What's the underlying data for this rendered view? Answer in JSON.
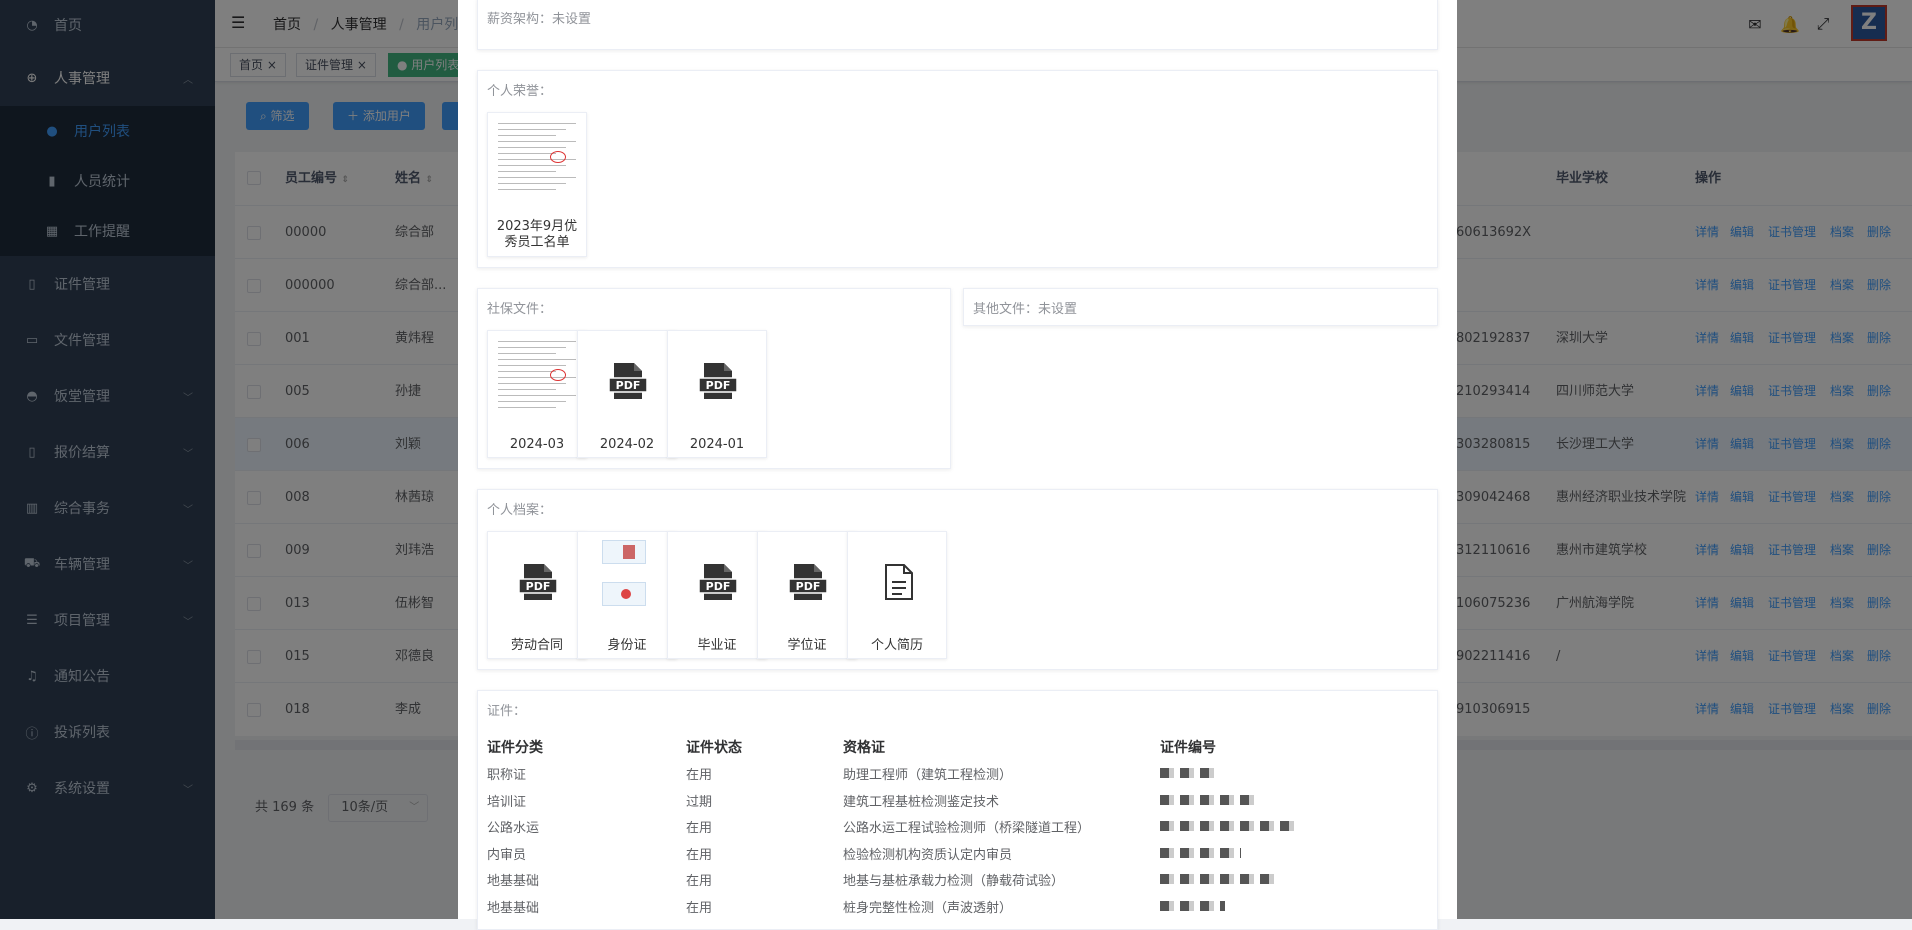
{
  "sidebar": {
    "items": [
      {
        "label": "首页",
        "icon": "dashboard-icon"
      },
      {
        "label": "人事管理",
        "icon": "plus-circle-icon",
        "expanded": true
      },
      {
        "label": "用户列表",
        "icon": "user-icon",
        "sub": true,
        "active": true
      },
      {
        "label": "人员统计",
        "icon": "bar-chart-icon",
        "sub": true
      },
      {
        "label": "工作提醒",
        "icon": "calendar-icon",
        "sub": true
      },
      {
        "label": "证件管理",
        "icon": "book-icon"
      },
      {
        "label": "文件管理",
        "icon": "folder-icon"
      },
      {
        "label": "饭堂管理",
        "icon": "bowl-icon",
        "chevron": true
      },
      {
        "label": "报价结算",
        "icon": "document-icon",
        "chevron": true
      },
      {
        "label": "综合事务",
        "icon": "chart-icon",
        "chevron": true
      },
      {
        "label": "车辆管理",
        "icon": "truck-icon",
        "chevron": true
      },
      {
        "label": "项目管理",
        "icon": "list-icon",
        "chevron": true
      },
      {
        "label": "通知公告",
        "icon": "bell-icon"
      },
      {
        "label": "投诉列表",
        "icon": "warning-icon"
      },
      {
        "label": "系统设置",
        "icon": "gear-icon",
        "chevron": true
      }
    ]
  },
  "navbar": {
    "breadcrumb": [
      "首页",
      "人事管理",
      "用户列表"
    ],
    "separator": "/"
  },
  "tags": [
    "首页",
    "证件管理",
    "用户列表"
  ],
  "toolbar": {
    "filter_label": "筛选",
    "add_label": "添加用户"
  },
  "table": {
    "headers": {
      "id": "员工编号",
      "name": "姓名",
      "school": "毕业学校",
      "ops": "操作"
    },
    "rows": [
      {
        "id": "00000",
        "name": "综合部",
        "idno": "60613692X",
        "school": ""
      },
      {
        "id": "000000",
        "name": "综合部...",
        "idno": "",
        "school": ""
      },
      {
        "id": "001",
        "name": "黄炜程",
        "idno": "802192837",
        "school": "深圳大学"
      },
      {
        "id": "005",
        "name": "孙捷",
        "idno": "210293414",
        "school": "四川师范大学"
      },
      {
        "id": "006",
        "name": "刘颖",
        "idno": "303280815",
        "school": "长沙理工大学"
      },
      {
        "id": "008",
        "name": "林茜琼",
        "idno": "309042468",
        "school": "惠州经济职业技术学院"
      },
      {
        "id": "009",
        "name": "刘玮浩",
        "idno": "312110616",
        "school": "惠州市建筑学校"
      },
      {
        "id": "013",
        "name": "伍彬智",
        "idno": "106075236",
        "school": "广州航海学院"
      },
      {
        "id": "015",
        "name": "邓德良",
        "idno": "902211416",
        "school": "/"
      },
      {
        "id": "018",
        "name": "李成",
        "idno": "910306915",
        "school": ""
      }
    ],
    "ops": [
      "详情",
      "编辑",
      "证书管理",
      "档案",
      "删除"
    ]
  },
  "pagination": {
    "total": "共 169 条",
    "page_size": "10条/页"
  },
  "dialog": {
    "salary_label": "薪资架构：未设置",
    "honors_label": "个人荣誉：",
    "honors": [
      {
        "caption": "2023年9月优秀员工名单"
      }
    ],
    "social_label": "社保文件：",
    "social": [
      {
        "caption": "2024-03",
        "kind": "image"
      },
      {
        "caption": "2024-02",
        "kind": "pdf"
      },
      {
        "caption": "2024-01",
        "kind": "pdf"
      }
    ],
    "other_label": "其他文件：未设置",
    "archive_label": "个人档案：",
    "archive": [
      {
        "caption": "劳动合同",
        "kind": "pdf"
      },
      {
        "caption": "身份证",
        "kind": "image"
      },
      {
        "caption": "毕业证",
        "kind": "pdf"
      },
      {
        "caption": "学位证",
        "kind": "pdf"
      },
      {
        "caption": "个人简历",
        "kind": "doc"
      }
    ],
    "pdf_text": "PDF",
    "cert_label": "证件：",
    "cert_headers": [
      "证件分类",
      "证件状态",
      "资格证",
      "证件编号"
    ],
    "certs": [
      [
        "职称证",
        "在用",
        "助理工程师（建筑工程检测）"
      ],
      [
        "培训证",
        "过期",
        "建筑工程基桩检测鉴定技术"
      ],
      [
        "公路水运",
        "在用",
        "公路水运工程试验检测师（桥梁隧道工程）"
      ],
      [
        "内审员",
        "在用",
        "检验检测机构资质认定内审员"
      ],
      [
        "地基基础",
        "在用",
        "地基与基桩承载力检测（静载荷试验）"
      ],
      [
        "地基基础",
        "在用",
        "桩身完整性检测（声波透射）"
      ]
    ]
  },
  "colors": {
    "sidebar": "#304156",
    "primary": "#409eff",
    "tag_active": "#42b983"
  }
}
